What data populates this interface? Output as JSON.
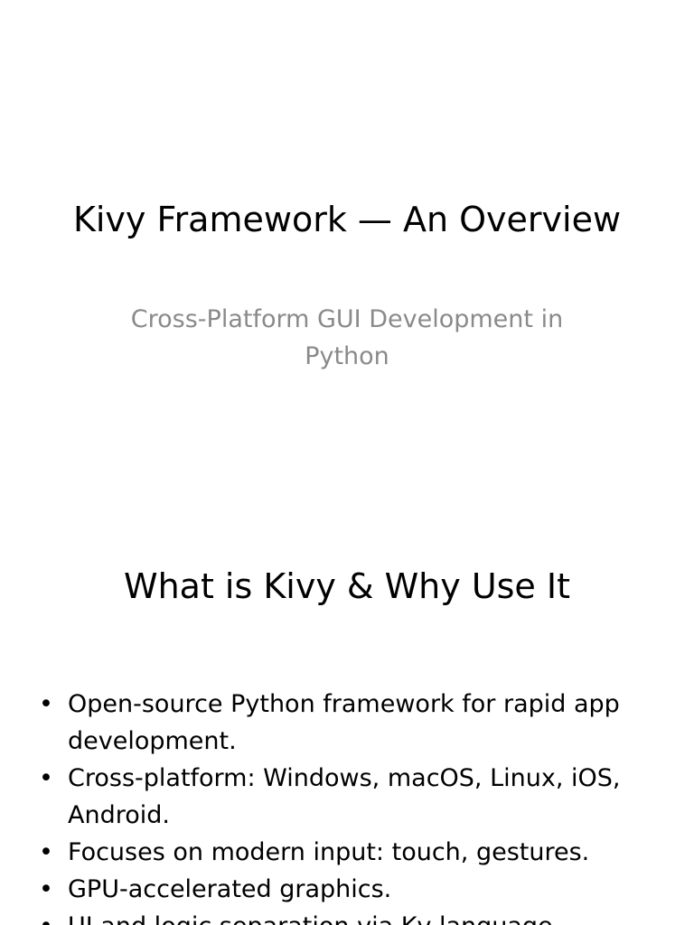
{
  "slide1": {
    "title": "Kivy Framework — An Overview",
    "subtitle": "Cross-Platform GUI Development in Python"
  },
  "slide2": {
    "title": "What is Kivy & Why Use It",
    "bullet_glyph": "•",
    "bullets": [
      "Open-source Python framework for rapid app development.",
      "Cross-platform: Windows, macOS, Linux, iOS, Android.",
      "Focuses on modern input: touch, gestures.",
      "GPU-accelerated graphics.",
      "UI and logic separation via Kv language."
    ]
  }
}
